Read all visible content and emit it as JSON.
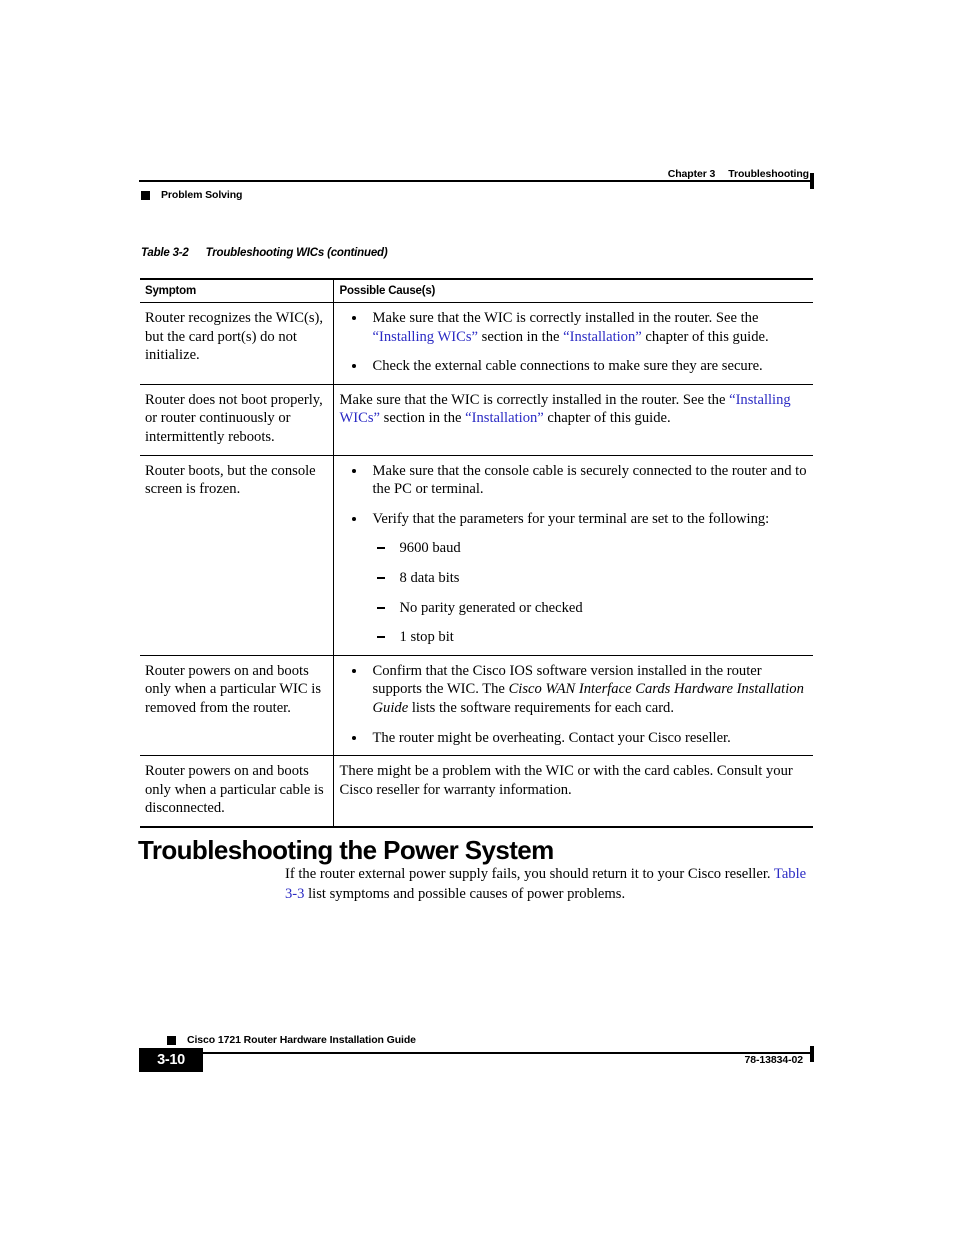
{
  "header": {
    "chapter_label": "Chapter 3",
    "chapter_title": "Troubleshooting",
    "section_label": "Problem Solving"
  },
  "table_caption": {
    "number": "Table 3-2",
    "title": "Troubleshooting WICs (continued)"
  },
  "table": {
    "columns": [
      "Symptom",
      "Possible Cause(s)"
    ],
    "rows": [
      {
        "symptom": "Router recognizes the WIC(s), but the card port(s) do not initialize.",
        "cause_type": "bullets",
        "bullets": [
          {
            "segments": [
              {
                "text": "Make sure that the WIC is correctly installed in the router. See the ",
                "style": "plain"
              },
              {
                "text": "“Installing WICs”",
                "style": "link"
              },
              {
                "text": " section in the ",
                "style": "plain"
              },
              {
                "text": "“Installation”",
                "style": "link"
              },
              {
                "text": " chapter of this guide.",
                "style": "plain"
              }
            ]
          },
          {
            "segments": [
              {
                "text": "Check the external cable connections to make sure they are secure.",
                "style": "plain"
              }
            ]
          }
        ]
      },
      {
        "symptom": "Router does not boot properly, or router continuously or intermittently reboots.",
        "cause_type": "paragraph",
        "paragraph": [
          {
            "text": "Make sure that the WIC is correctly installed in the router. See the ",
            "style": "plain"
          },
          {
            "text": "“Installing WICs”",
            "style": "link"
          },
          {
            "text": " section in the ",
            "style": "plain"
          },
          {
            "text": "“Installation”",
            "style": "link"
          },
          {
            "text": " chapter of this guide.",
            "style": "plain"
          }
        ]
      },
      {
        "symptom": "Router boots, but the console screen is frozen.",
        "cause_type": "bullets",
        "bullets": [
          {
            "segments": [
              {
                "text": "Make sure that the console cable is securely connected to the router and to the PC or terminal.",
                "style": "plain"
              }
            ]
          },
          {
            "segments": [
              {
                "text": "Verify that the parameters for your terminal are set to the following:",
                "style": "plain"
              }
            ],
            "subitems": [
              "9600 baud",
              "8 data bits",
              "No parity generated or checked",
              "1 stop bit"
            ]
          }
        ]
      },
      {
        "symptom": "Router powers on and boots only when a particular WIC is removed from the router.",
        "cause_type": "bullets",
        "bullets": [
          {
            "segments": [
              {
                "text": "Confirm that the Cisco IOS software version installed in the router supports the WIC. The ",
                "style": "plain"
              },
              {
                "text": "Cisco WAN Interface Cards Hardware Installation Guide",
                "style": "italic"
              },
              {
                "text": " lists the software requirements for each card.",
                "style": "plain"
              }
            ]
          },
          {
            "segments": [
              {
                "text": "The router might be overheating. Contact your Cisco reseller.",
                "style": "plain"
              }
            ]
          }
        ]
      },
      {
        "symptom": "Router powers on and boots only when a particular cable is disconnected.",
        "cause_type": "paragraph",
        "paragraph": [
          {
            "text": "There might be a problem with the WIC or with the card cables. Consult your Cisco reseller for warranty information.",
            "style": "plain"
          }
        ]
      }
    ]
  },
  "section": {
    "heading": "Troubleshooting the Power System",
    "paragraph": [
      {
        "text": "If the router external power supply fails, you should return it to your Cisco reseller. ",
        "style": "plain"
      },
      {
        "text": "Table 3-3",
        "style": "link"
      },
      {
        "text": " list symptoms and possible causes of power problems.",
        "style": "plain"
      }
    ]
  },
  "footer": {
    "guide_title": "Cisco 1721 Router Hardware Installation Guide",
    "page_number": "3-10",
    "document_number": "78-13834-02"
  },
  "colors": {
    "link": "#2b2bc4",
    "rule": "#000000",
    "page_background": "#ffffff"
  }
}
